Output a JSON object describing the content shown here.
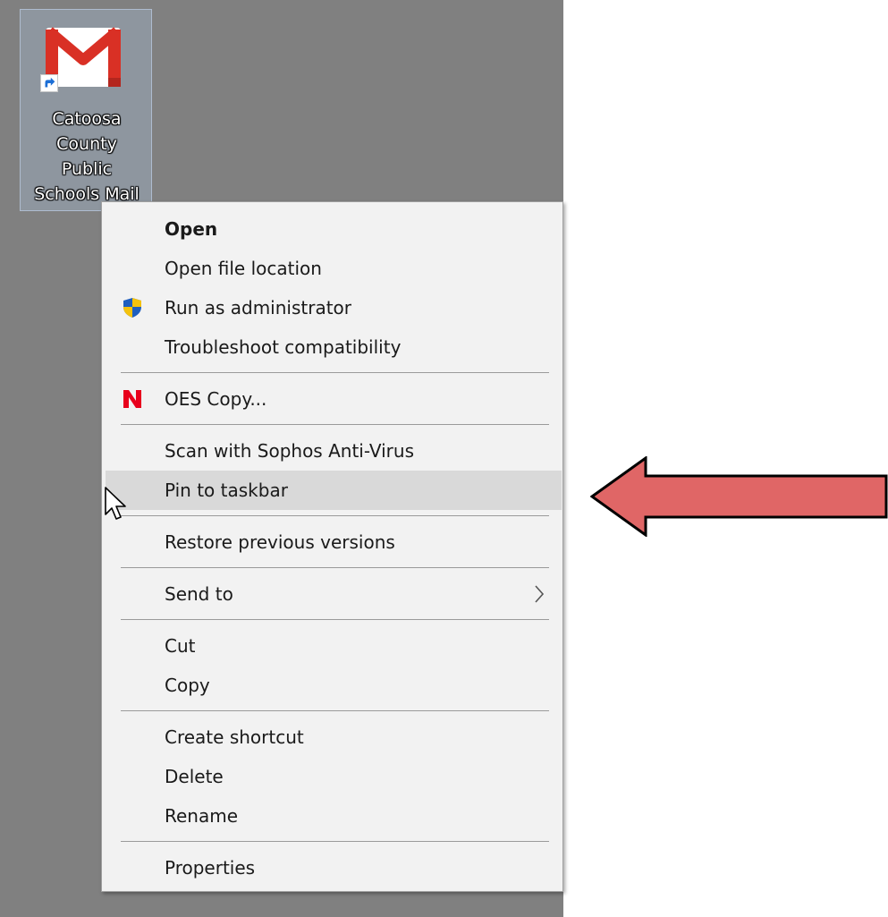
{
  "desktop_icon": {
    "label_lines": [
      "Catoosa",
      "County",
      "Public",
      "Schools Mail"
    ],
    "icon": "gmail-icon",
    "badge": "shortcut-arrow-icon"
  },
  "menu": {
    "items": [
      {
        "label": "Open",
        "bold": true
      },
      {
        "label": "Open file location"
      },
      {
        "label": "Run as administrator",
        "icon": "uac-shield-icon"
      },
      {
        "label": "Troubleshoot compatibility"
      },
      {
        "label": "OES Copy...",
        "icon": "novell-n-icon"
      },
      {
        "label": "Scan with Sophos Anti-Virus"
      },
      {
        "label": "Pin to taskbar",
        "highlighted": true
      },
      {
        "label": "Restore previous versions"
      },
      {
        "label": "Send to",
        "submenu": true
      },
      {
        "label": "Cut"
      },
      {
        "label": "Copy"
      },
      {
        "label": "Create shortcut"
      },
      {
        "label": "Delete"
      },
      {
        "label": "Rename"
      },
      {
        "label": "Properties"
      }
    ]
  },
  "colors": {
    "desktop": "#808080",
    "menu_bg": "#f2f2f2",
    "highlight": "#d9d9d9",
    "arrow_fill": "#e06666",
    "novell_red": "#e8001c",
    "gmail_red": "#d93025"
  }
}
